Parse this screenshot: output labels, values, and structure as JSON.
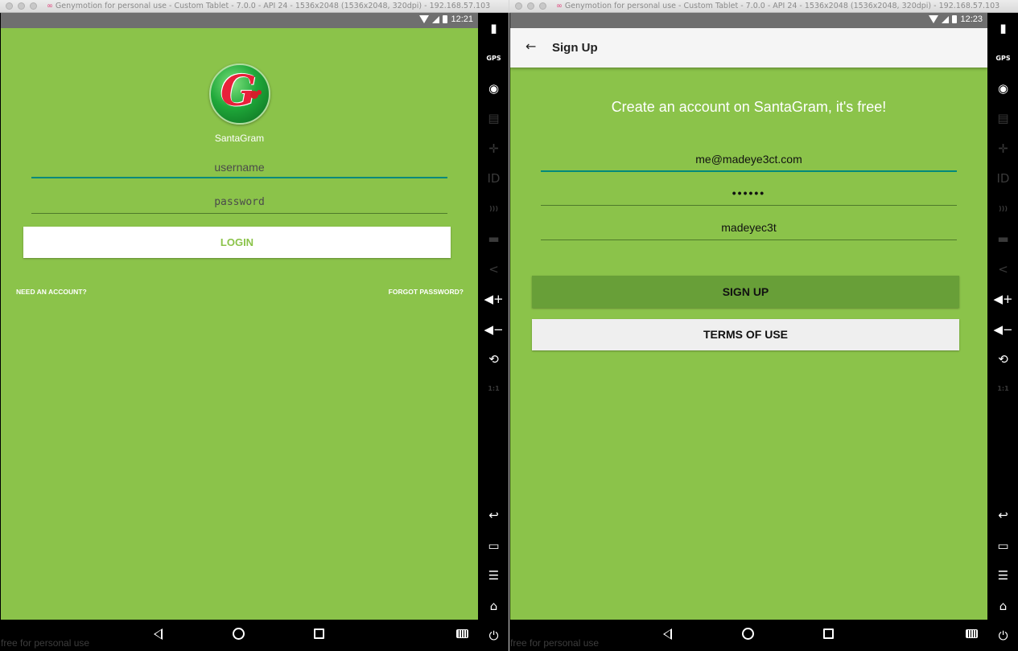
{
  "left_window": {
    "title": "Genymotion for personal use - Custom Tablet - 7.0.0 - API 24 - 1536x2048 (1536x2048, 320dpi) - 192.168.57.103",
    "status_time": "12:21",
    "app_name": "SantaGram",
    "logo_letter": "G",
    "username_placeholder": "username",
    "password_placeholder": "password",
    "login_button": "LOGIN",
    "need_account": "NEED AN ACCOUNT?",
    "forgot_password": "FORGOT PASSWORD?",
    "watermark": "free for personal use"
  },
  "right_window": {
    "title": "Genymotion for personal use - Custom Tablet - 7.0.0 - API 24 - 1536x2048 (1536x2048, 320dpi) - 192.168.57.103",
    "status_time": "12:23",
    "back_glyph": "←",
    "toolbar_title": "Sign Up",
    "heading": "Create an account on SantaGram, it's free!",
    "email_value": "me@madeye3ct.com",
    "password_value": "••••••",
    "username_value": "madeyec3t",
    "signup_button": "SIGN UP",
    "terms_button": "TERMS OF USE",
    "watermark": "free for personal use"
  },
  "side_panel": {
    "items": [
      {
        "name": "battery-icon",
        "glyph": "▮"
      },
      {
        "name": "gps-icon",
        "glyph": "GPS"
      },
      {
        "name": "camera-icon",
        "glyph": "◉"
      },
      {
        "name": "capture-icon",
        "glyph": "▤"
      },
      {
        "name": "dpad-icon",
        "glyph": "✛"
      },
      {
        "name": "id-icon",
        "glyph": "ID"
      },
      {
        "name": "network-icon",
        "glyph": ")))"
      },
      {
        "name": "sms-icon",
        "glyph": "▬"
      },
      {
        "name": "share-icon",
        "glyph": "<"
      },
      {
        "name": "volume-up-icon",
        "glyph": "◀+"
      },
      {
        "name": "volume-down-icon",
        "glyph": "◀−"
      },
      {
        "name": "rotate-icon",
        "glyph": "⟲"
      },
      {
        "name": "scale-icon",
        "glyph": "1:1"
      },
      {
        "name": "back-icon",
        "glyph": "↩"
      },
      {
        "name": "recent-apps-icon",
        "glyph": "▭"
      },
      {
        "name": "menu-icon",
        "glyph": "☰"
      },
      {
        "name": "home-icon",
        "glyph": "⌂"
      },
      {
        "name": "power-icon",
        "glyph": "⏻"
      }
    ]
  },
  "colors": {
    "app_background": "#8bc34a",
    "signup_button": "#689f38",
    "focus_underline": "#00897b"
  }
}
